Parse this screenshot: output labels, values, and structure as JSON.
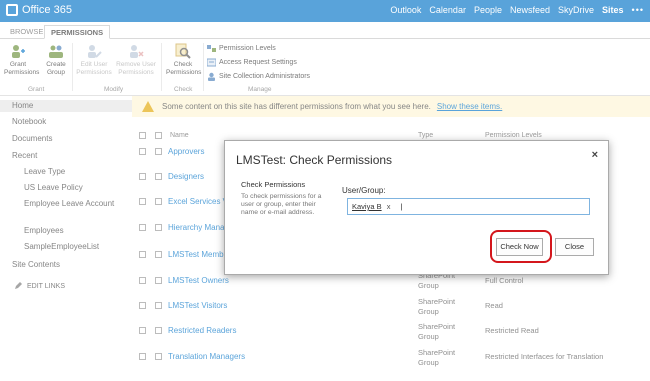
{
  "suitebar": {
    "brand": "Office 365",
    "nav": [
      "Outlook",
      "Calendar",
      "People",
      "Newsfeed",
      "SkyDrive",
      "Sites"
    ],
    "active": "Sites",
    "more": "•••"
  },
  "ribbon": {
    "tabs": [
      "BROWSE",
      "PERMISSIONS"
    ],
    "active_tab": "PERMISSIONS",
    "buttons": {
      "grant": "Grant\nPermissions",
      "create_group": "Create\nGroup",
      "edit_user": "Edit User\nPermissions",
      "remove_user": "Remove User\nPermissions",
      "check": "Check\nPermissions"
    },
    "small_buttons": [
      "Permission Levels",
      "Access Request Settings",
      "Site Collection Administrators"
    ],
    "groups": [
      "Grant",
      "Modify",
      "Check",
      "Manage"
    ]
  },
  "leftnav": {
    "home": "Home",
    "notebook": "Notebook",
    "documents": "Documents",
    "recent": "Recent",
    "recent_items": [
      "Leave Type",
      "US Leave Policy",
      "Employee Leave Account",
      "Employees",
      "SampleEmployeeList"
    ],
    "site_contents": "Site Contents",
    "edit_links": "EDIT LINKS"
  },
  "warning": {
    "text": "Some content on this site has different permissions from what you see here.",
    "link": "Show these items."
  },
  "list": {
    "headers": {
      "name": "Name",
      "type": "Type",
      "perm": "Permission Levels"
    },
    "rows": [
      {
        "name": "Approvers",
        "type": "",
        "perm": ""
      },
      {
        "name": "Designers",
        "type": "",
        "perm": ""
      },
      {
        "name": "Excel Services V",
        "type": "",
        "perm": ""
      },
      {
        "name": "Hierarchy Mana",
        "type": "",
        "perm": ""
      },
      {
        "name": "LMSTest Memb",
        "type": "",
        "perm": ""
      },
      {
        "name": "LMSTest Owners",
        "type": "SharePoint Group",
        "perm": "Full Control"
      },
      {
        "name": "LMSTest Visitors",
        "type": "SharePoint Group",
        "perm": "Read"
      },
      {
        "name": "Restricted Readers",
        "type": "SharePoint Group",
        "perm": "Restricted Read"
      },
      {
        "name": "Translation Managers",
        "type": "SharePoint Group",
        "perm": "Restricted Interfaces for Translation"
      }
    ]
  },
  "dialog": {
    "title": "LMSTest: Check Permissions",
    "close": "×",
    "section_title": "Check Permissions",
    "section_desc": "To check permissions for a user or group, enter their name or e-mail address.",
    "field_label": "User/Group:",
    "field_value": "Kaviya B",
    "remove_x": "x",
    "caret": "|",
    "check_now": "Check Now",
    "close_button": "Close"
  },
  "colors": {
    "suitebar": "#0072c6",
    "link": "#0072c6",
    "warning_bg": "#fdf5d4",
    "highlight": "#d4161c"
  }
}
